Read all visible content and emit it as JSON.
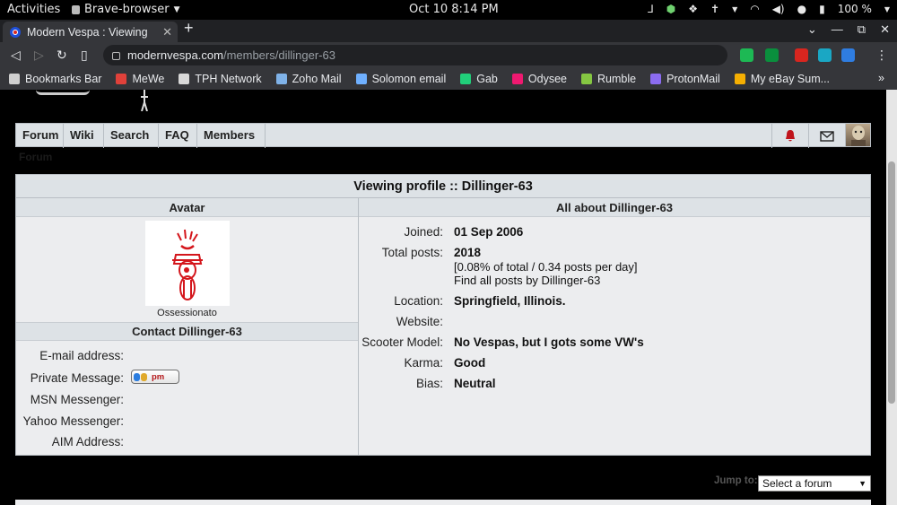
{
  "os_bar": {
    "activities": "Activities",
    "app_name": "Brave-browser",
    "clock": "Oct 10  8:14 PM",
    "battery": "100 %"
  },
  "browser": {
    "tab_title": "Modern Vespa : Viewing profile",
    "url_host": "modernvespa.com",
    "url_path": "/members/dillinger-63",
    "bookmarks": [
      {
        "label": "Bookmarks Bar",
        "icon": "folder-icon",
        "color": "#cfcfcf"
      },
      {
        "label": "MeWe",
        "icon": "mewe-icon",
        "color": "#e0413a"
      },
      {
        "label": "TPH Network",
        "icon": "tph-icon",
        "color": "#d8d8d8"
      },
      {
        "label": "Zoho Mail",
        "icon": "zoho-icon",
        "color": "#7fb2e8"
      },
      {
        "label": "Solomon email",
        "icon": "solomon-icon",
        "color": "#6fb0ff"
      },
      {
        "label": "Gab",
        "icon": "gab-icon",
        "color": "#21cf7a"
      },
      {
        "label": "Odysee",
        "icon": "odysee-icon",
        "color": "#ef1970"
      },
      {
        "label": "Rumble",
        "icon": "rumble-icon",
        "color": "#85c742"
      },
      {
        "label": "ProtonMail",
        "icon": "protonmail-icon",
        "color": "#8b6cf0"
      },
      {
        "label": "My eBay Sum...",
        "icon": "ebay-icon",
        "color": "#f5af02"
      }
    ]
  },
  "nav": {
    "links": [
      "Forum",
      "Wiki",
      "Search",
      "FAQ",
      "Members"
    ],
    "breadcrumb": "Forum"
  },
  "profile": {
    "title": "Viewing profile :: Dillinger-63",
    "avatar_heading": "Avatar",
    "about_heading": "All about Dillinger-63",
    "rank": "Ossessionato",
    "contact_heading": "Contact Dillinger-63",
    "contact_labels": {
      "email": "E-mail address:",
      "pm": "Private Message:",
      "msn": "MSN Messenger:",
      "yahoo": "Yahoo Messenger:",
      "aim": "AIM Address:"
    },
    "pm_button_text": "pm",
    "fields": {
      "joined_label": "Joined:",
      "joined_value": "01 Sep 2006",
      "posts_label": "Total posts:",
      "posts_value": "2018",
      "posts_stats": "[0.08% of total / 0.34 posts per day]",
      "posts_link": "Find all posts by Dillinger-63",
      "location_label": "Location:",
      "location_value": "Springfield, Illinois.",
      "website_label": "Website:",
      "website_value": "",
      "scooter_label": "Scooter Model:",
      "scooter_value": "No Vespas, but I gots some VW's",
      "karma_label": "Karma:",
      "karma_value": "Good",
      "bias_label": "Bias:",
      "bias_value": "Neutral"
    }
  },
  "jump": {
    "label": "Jump to:",
    "selected": "Select a forum"
  }
}
